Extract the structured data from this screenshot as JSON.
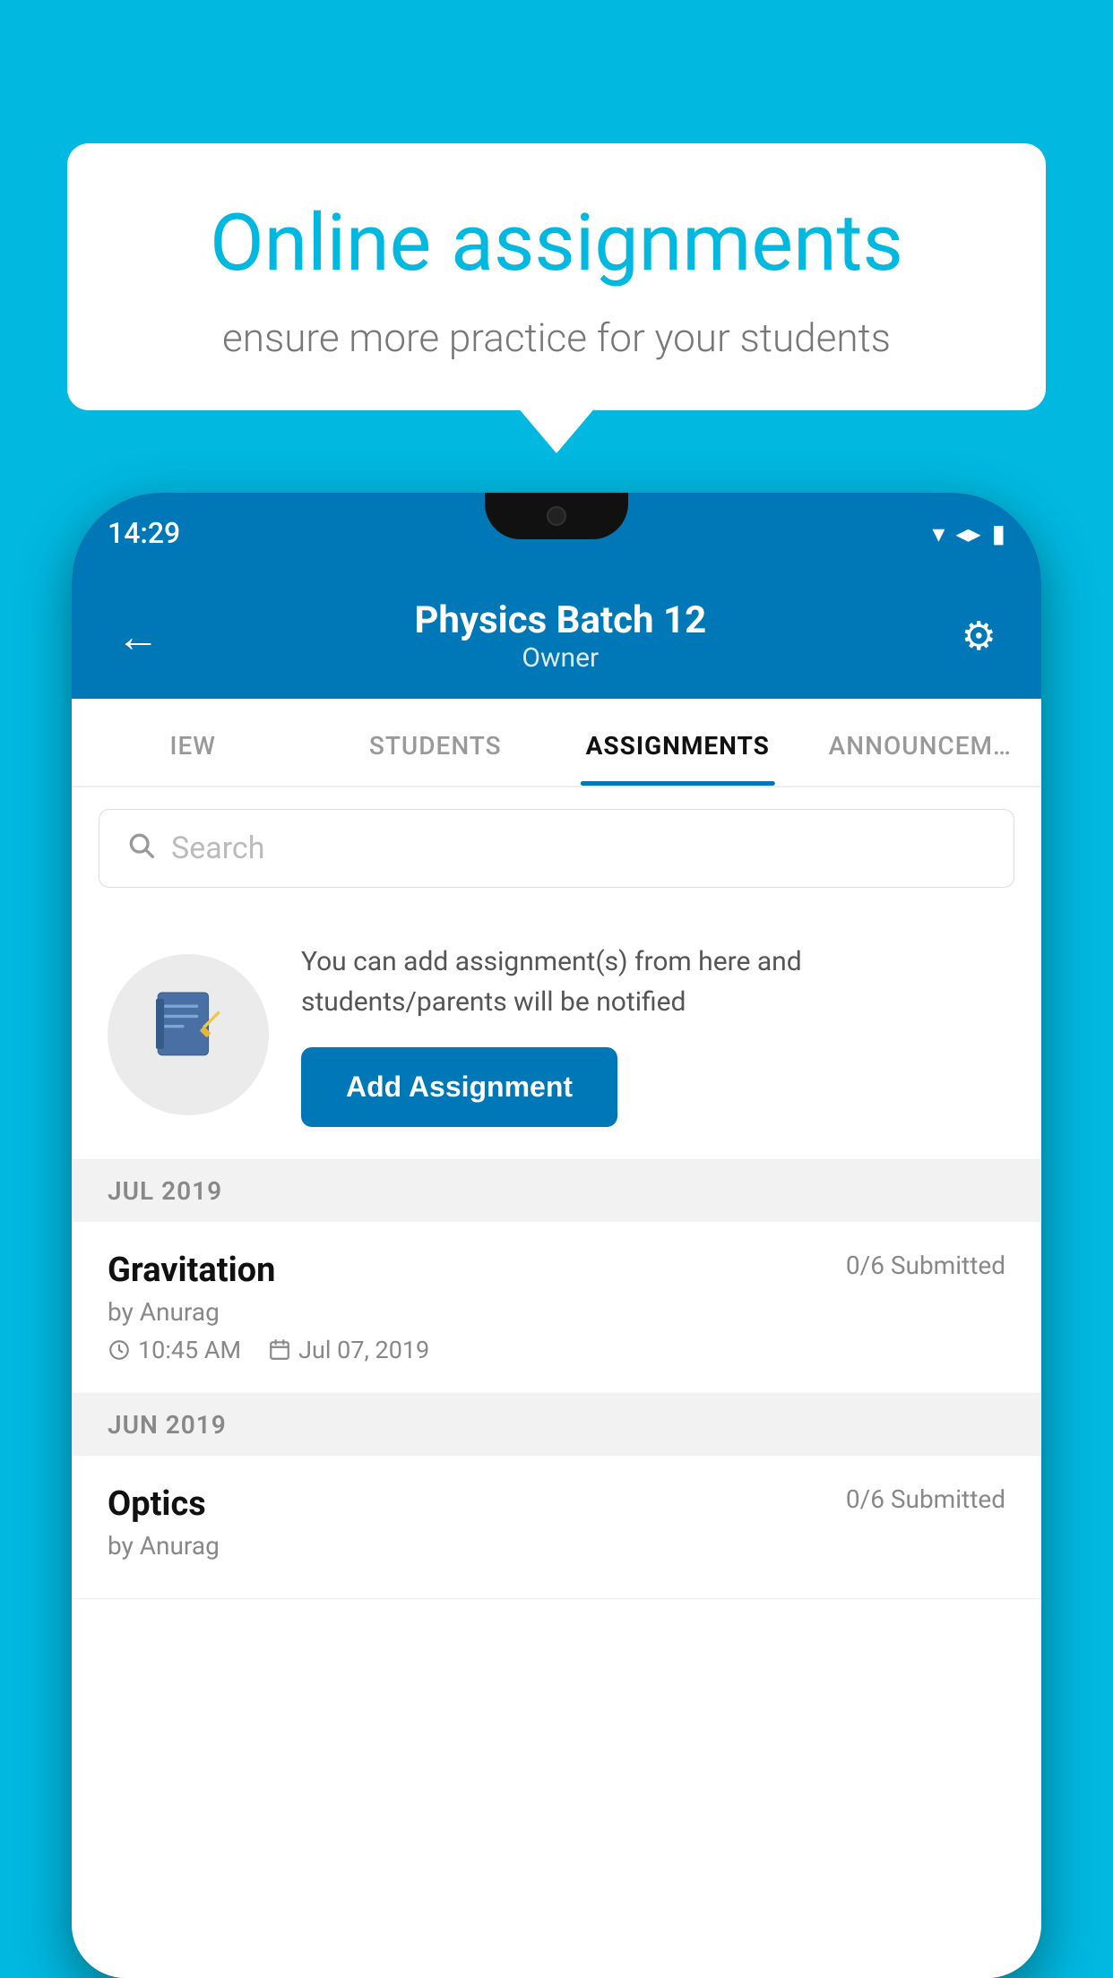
{
  "background_color": "#00B8E0",
  "speech_bubble": {
    "title": "Online assignments",
    "subtitle": "ensure more practice for your students"
  },
  "status_bar": {
    "time": "14:29",
    "wifi_icon": "▼",
    "signal_icon": "▲",
    "battery_icon": "▮"
  },
  "header": {
    "back_icon": "←",
    "title": "Physics Batch 12",
    "subtitle": "Owner",
    "settings_icon": "⚙"
  },
  "tabs": [
    {
      "label": "IEW",
      "active": false
    },
    {
      "label": "STUDENTS",
      "active": false
    },
    {
      "label": "ASSIGNMENTS",
      "active": true
    },
    {
      "label": "ANNOUNCEM...",
      "active": false
    }
  ],
  "search": {
    "placeholder": "Search",
    "icon": "🔍"
  },
  "info_card": {
    "icon": "📓",
    "text": "You can add assignment(s) from here and students/parents will be notified",
    "button_label": "Add Assignment"
  },
  "sections": [
    {
      "month": "JUL 2019",
      "assignments": [
        {
          "name": "Gravitation",
          "submitted": "0/6 Submitted",
          "by": "by Anurag",
          "time": "10:45 AM",
          "date": "Jul 07, 2019"
        }
      ]
    },
    {
      "month": "JUN 2019",
      "assignments": [
        {
          "name": "Optics",
          "submitted": "0/6 Submitted",
          "by": "by Anurag",
          "time": "",
          "date": ""
        }
      ]
    }
  ]
}
